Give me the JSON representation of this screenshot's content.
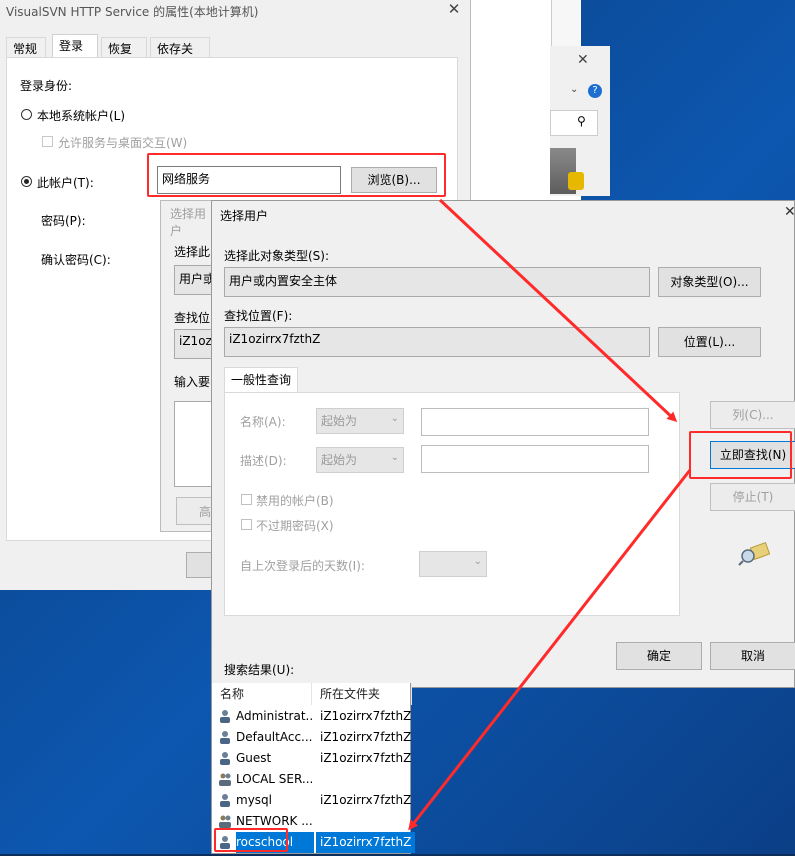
{
  "props_window": {
    "title": "VisualSVN HTTP Service 的属性(本地计算机)",
    "close": "✕",
    "tabs": [
      "常规",
      "登录",
      "恢复",
      "依存关系"
    ],
    "logon_as": "登录身份:",
    "local_system": "本地系统帐户(L)",
    "allow_desktop": "允许服务与桌面交互(W)",
    "this_account": "此帐户(T):",
    "account_value": "网络服务",
    "browse_button": "浏览(B)...",
    "password": "密码(P):",
    "confirm_password": "确认密码(C):"
  },
  "underlying_dialog": {
    "title": "选择用户",
    "select_type": "选择此",
    "type_value": "用户或",
    "location": "查找位",
    "location_value": "iZ1oz",
    "enter": "输入要",
    "button": "高"
  },
  "dialog": {
    "title": "选择用户",
    "close": "✕",
    "object_type_label": "选择此对象类型(S):",
    "object_type_value": "用户或内置安全主体",
    "object_types_button": "对象类型(O)...",
    "location_label": "查找位置(F):",
    "location_value": "iZ1ozirrx7fzthZ",
    "locations_button": "位置(L)...",
    "general_tab": "一般性查询",
    "name_label": "名称(A):",
    "name_combo": "起始为",
    "desc_label": "描述(D):",
    "desc_combo": "起始为",
    "disabled_accounts": "禁用的帐户(B)",
    "non_expiring": "不过期密码(X)",
    "days_since": "自上次登录后的天数(I):",
    "columns_button": "列(C)...",
    "find_now_button": "立即查找(N)",
    "stop_button": "停止(T)",
    "ok_button": "确定",
    "cancel_button": "取消",
    "results_label": "搜索结果(U):"
  },
  "results": {
    "headers": [
      "名称",
      "所在文件夹"
    ],
    "rows": [
      {
        "name": "Administrat...",
        "folder": "iZ1ozirrx7fzthZ"
      },
      {
        "name": "DefaultAcc...",
        "folder": "iZ1ozirrx7fzthZ"
      },
      {
        "name": "Guest",
        "folder": "iZ1ozirrx7fzthZ"
      },
      {
        "name": "LOCAL SER...",
        "folder": ""
      },
      {
        "name": "mysql",
        "folder": "iZ1ozirrx7fzthZ"
      },
      {
        "name": "NETWORK ...",
        "folder": ""
      },
      {
        "name": "rocschool",
        "folder": "iZ1ozirrx7fzthZ"
      }
    ]
  },
  "colors": {
    "annotation": "#ff2a2a",
    "selection": "#0078d7"
  }
}
